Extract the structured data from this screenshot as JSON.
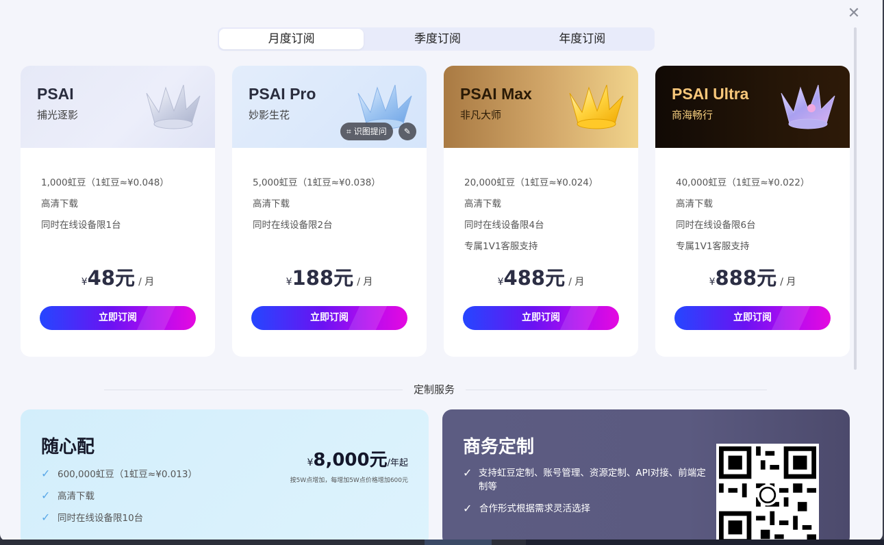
{
  "tabs": [
    "月度订阅",
    "季度订阅",
    "年度订阅"
  ],
  "plans": [
    {
      "title": "PSAI",
      "subtitle": "捕光逐影",
      "features": [
        "1,000虹豆（1虹豆≈¥0.048）",
        "高清下载",
        "同时在线设备限1台"
      ],
      "currency": "¥",
      "price": "48元",
      "unit": "/ 月",
      "button": "立即订阅"
    },
    {
      "title": "PSAI Pro",
      "subtitle": "妙影生花",
      "features": [
        "5,000虹豆（1虹豆≈¥0.038）",
        "高清下载",
        "同时在线设备限2台"
      ],
      "currency": "¥",
      "price": "188元",
      "unit": "/ 月",
      "button": "立即订阅"
    },
    {
      "title": "PSAI Max",
      "subtitle": "非凡大师",
      "features": [
        "20,000虹豆（1虹豆≈¥0.024）",
        "高清下载",
        "同时在线设备限4台",
        "专属1V1客服支持"
      ],
      "currency": "¥",
      "price": "488元",
      "unit": "/ 月",
      "button": "立即订阅"
    },
    {
      "title": "PSAI Ultra",
      "subtitle": "商海畅行",
      "features": [
        "40,000虹豆（1虹豆≈¥0.022）",
        "高清下载",
        "同时在线设备限6台",
        "专属1V1客服支持"
      ],
      "currency": "¥",
      "price": "888元",
      "unit": "/ 月",
      "button": "立即订阅"
    }
  ],
  "image_tools": {
    "recognize": "识图提问",
    "edit_icon": "image-edit-icon"
  },
  "divider_label": "定制服务",
  "custom_left": {
    "title": "随心配",
    "features": [
      "600,000虹豆（1虹豆≈¥0.013）",
      "高清下载",
      "同时在线设备限10台"
    ],
    "currency": "¥",
    "price": "8,000元",
    "unit": "/年起",
    "note": "按5W点增加，每增加5W点价格增加600元"
  },
  "custom_right": {
    "title": "商务定制",
    "features": [
      "支持虹豆定制、账号管理、资源定制、API对接、前端定制等",
      "合作形式根据需求灵活选择"
    ]
  },
  "colors": {
    "accent_start": "#2546ff",
    "accent_end": "#e40ae0"
  }
}
